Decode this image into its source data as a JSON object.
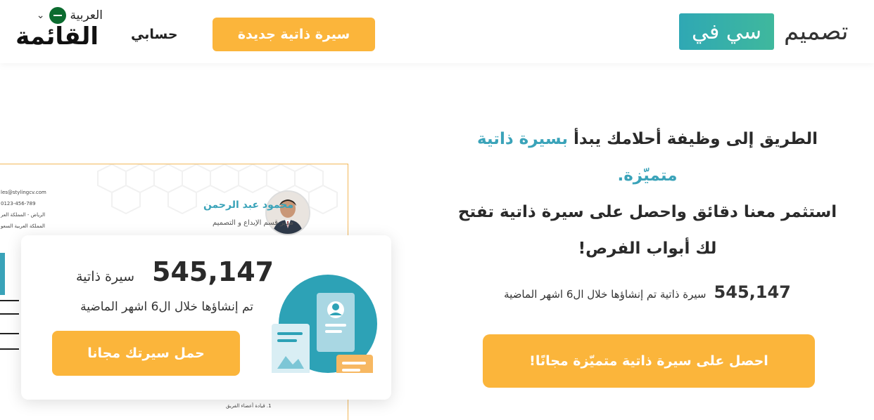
{
  "header": {
    "logo_word": "تصميم",
    "logo_mark": "سي في",
    "new_cv_label": "سيرة ذاتية جديدة",
    "account_label": "حسابي",
    "language_label": "العربية",
    "menu_title": "القائمة"
  },
  "hero": {
    "title_part1": "الطريق إلى وظيفة أحلامك يبدأ ",
    "title_accent": "بسيرة ذاتية متميّزة.",
    "title_part2": "استثمر معنا دقائق واحصل على سيرة ذاتية تفتح لك أبواب الفرص!",
    "count": "545,147",
    "count_text": "سيرة ذاتية تم إنشاؤها خلال ال6 اشهر الماضية",
    "cta_label": "احصل على سيرة ذاتية متميّزة مجانًا!"
  },
  "resume_preview": {
    "name": "محمود عبد الرحمن",
    "role": "مدير قسم الإبداع و التصميم",
    "email": "les@stylingcv.com",
    "phone": "0123-456-789",
    "address1": "الرياض - المملكة العر",
    "address2": "المملكة العربية السعو",
    "bottom_item": "1. قيادة أعضاء الفريق"
  },
  "stats_card": {
    "count": "545,147",
    "count_label": "سيرة ذاتية",
    "subtitle": "تم إنشاؤها خلال ال6 اشهر الماضية",
    "button_label": "حمل سيرتك مجانا"
  },
  "colors": {
    "accent_orange": "#fbb53b",
    "accent_teal": "#3aa3b9",
    "logo_gradient_start": "#2fa8b4",
    "logo_gradient_end": "#3fb89d"
  },
  "icons": {
    "language_flag": "saudi-flag-icon",
    "menu_chevron": "chevron-down-icon",
    "card_illustration": "cv-documents-illustration"
  }
}
